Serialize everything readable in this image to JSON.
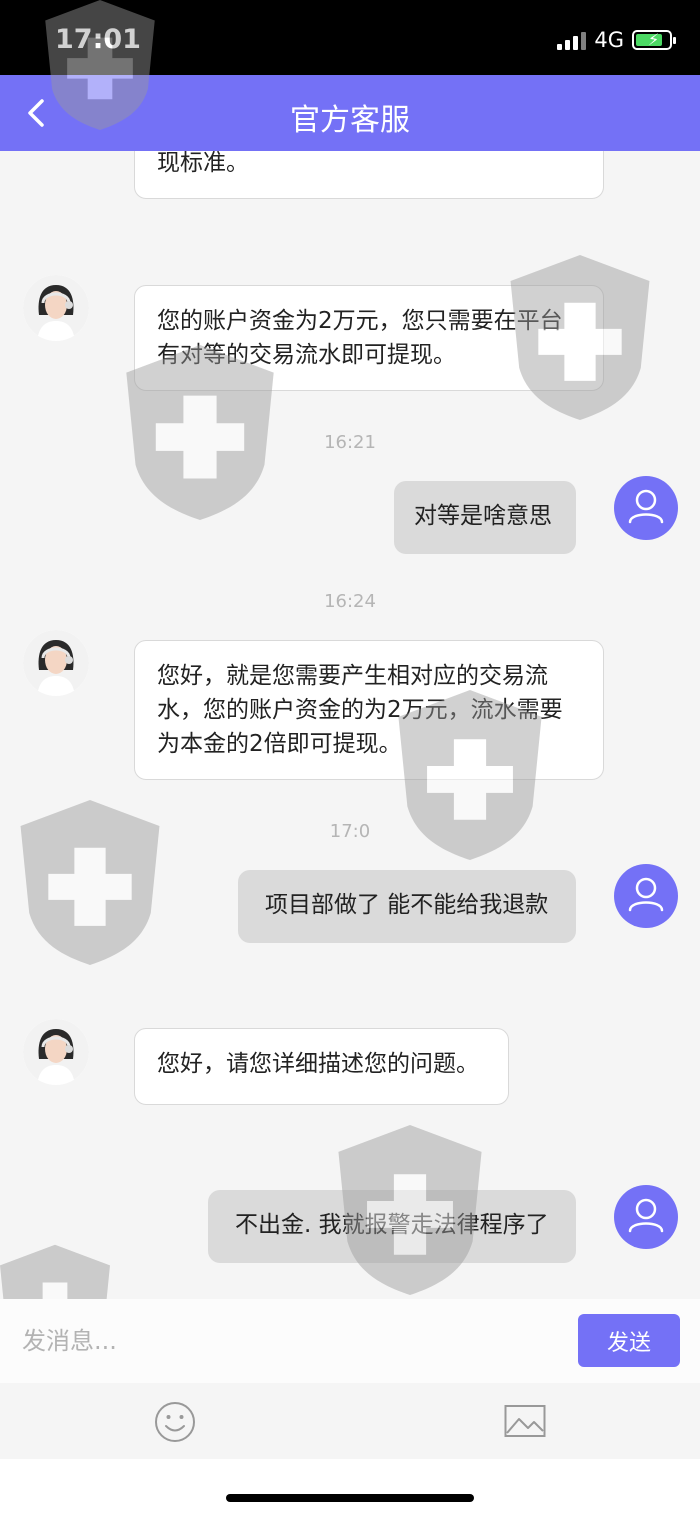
{
  "status_bar": {
    "time": "17:01",
    "network": "4G"
  },
  "header": {
    "title": "官方客服"
  },
  "messages": [
    {
      "text": "现标准。"
    },
    {
      "text": "您的账户资金为2万元，您只需要在平台有对等的交易流水即可提现。"
    },
    {
      "text": "对等是啥意思"
    },
    {
      "text": "您好，就是您需要产生相对应的交易流水，您的账户资金的为2万元，流水需要为本金的2倍即可提现。"
    },
    {
      "text": "项目部做了 能不能给我退款"
    },
    {
      "text": "您好，请您详细描述您的问题。"
    },
    {
      "text": "不出金. 我就报警走法律程序了"
    }
  ],
  "timestamps": [
    "16:21",
    "16:24",
    "17:0"
  ],
  "composer": {
    "placeholder": "发消息...",
    "send_label": "发送"
  },
  "colors": {
    "accent": "#7471f6",
    "status_bar": "#000000",
    "incoming_bubble": "#ffffff",
    "outgoing_bubble": "#dadada"
  }
}
